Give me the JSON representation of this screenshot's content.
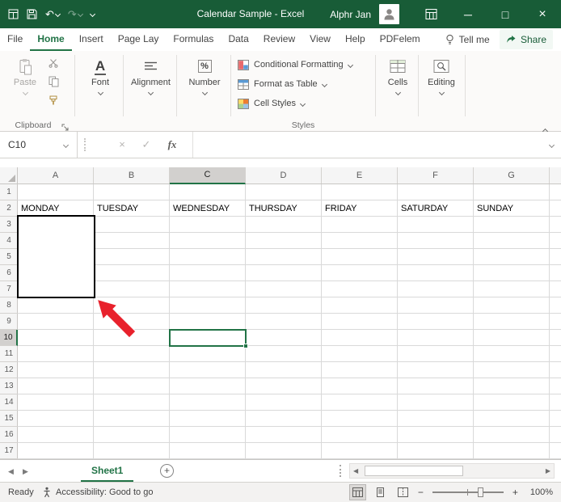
{
  "titlebar": {
    "title": "Calendar Sample - Excel",
    "user_name": "Alphr Jan"
  },
  "tabs": {
    "items": [
      "File",
      "Home",
      "Insert",
      "Page Lay",
      "Formulas",
      "Data",
      "Review",
      "View",
      "Help",
      "PDFelem"
    ],
    "active_tab": "Home",
    "tell_me": "Tell me",
    "share": "Share"
  },
  "ribbon": {
    "paste": "Paste",
    "font": "Font",
    "alignment": "Alignment",
    "number": "Number",
    "conditional_formatting": "Conditional Formatting",
    "format_as_table": "Format as Table",
    "cell_styles": "Cell Styles",
    "cells": "Cells",
    "editing": "Editing",
    "clipboard_group": "Clipboard",
    "styles_group": "Styles"
  },
  "formula_bar": {
    "name_box": "C10",
    "fx": "fx",
    "formula_value": ""
  },
  "grid": {
    "column_headers": [
      "A",
      "B",
      "C",
      "D",
      "E",
      "F",
      "G"
    ],
    "row_headers": [
      "1",
      "2",
      "3",
      "4",
      "5",
      "6",
      "7",
      "8",
      "9",
      "10",
      "11",
      "12",
      "13",
      "14",
      "15",
      "16",
      "17"
    ],
    "day_names": [
      "MONDAY",
      "TUESDAY",
      "WEDNESDAY",
      "THURSDAY",
      "FRIDAY",
      "SATURDAY",
      "SUNDAY"
    ],
    "selected_cell": "C10",
    "accent_color": "#217346"
  },
  "sheet_bar": {
    "sheet_name": "Sheet1"
  },
  "status_bar": {
    "mode": "Ready",
    "accessibility": "Accessibility: Good to go",
    "zoom_level": "100%"
  },
  "icons": {
    "undo": "↶",
    "redo": "↷",
    "minimize": "─",
    "maximize": "□",
    "close": "×",
    "cancel": "×",
    "enter": "✓",
    "left_arrow": "◀",
    "right_arrow": "▶",
    "plus": "+",
    "minus": "−",
    "font_a": "A",
    "percent": "%"
  }
}
